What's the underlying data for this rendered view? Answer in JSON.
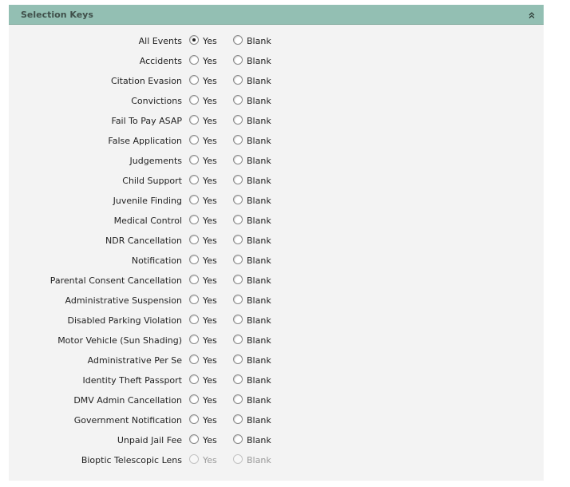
{
  "panel": {
    "title": "Selection Keys",
    "collapse_icon": "double-chevron-up-icon"
  },
  "options": {
    "yes": "Yes",
    "blank": "Blank"
  },
  "rows": [
    {
      "label": "All Events",
      "selected": "yes",
      "disabled": false
    },
    {
      "label": "Accidents",
      "selected": null,
      "disabled": false
    },
    {
      "label": "Citation Evasion",
      "selected": null,
      "disabled": false
    },
    {
      "label": "Convictions",
      "selected": null,
      "disabled": false
    },
    {
      "label": "Fail To Pay ASAP",
      "selected": null,
      "disabled": false
    },
    {
      "label": "False Application",
      "selected": null,
      "disabled": false
    },
    {
      "label": "Judgements",
      "selected": null,
      "disabled": false
    },
    {
      "label": "Child Support",
      "selected": null,
      "disabled": false
    },
    {
      "label": "Juvenile Finding",
      "selected": null,
      "disabled": false
    },
    {
      "label": "Medical Control",
      "selected": null,
      "disabled": false
    },
    {
      "label": "NDR Cancellation",
      "selected": null,
      "disabled": false
    },
    {
      "label": "Notification",
      "selected": null,
      "disabled": false
    },
    {
      "label": "Parental Consent Cancellation",
      "selected": null,
      "disabled": false
    },
    {
      "label": "Administrative Suspension",
      "selected": null,
      "disabled": false
    },
    {
      "label": "Disabled Parking Violation",
      "selected": null,
      "disabled": false
    },
    {
      "label": "Motor Vehicle (Sun Shading)",
      "selected": null,
      "disabled": false
    },
    {
      "label": "Administrative Per Se",
      "selected": null,
      "disabled": false
    },
    {
      "label": "Identity Theft Passport",
      "selected": null,
      "disabled": false
    },
    {
      "label": "DMV Admin Cancellation",
      "selected": null,
      "disabled": false
    },
    {
      "label": "Government Notification",
      "selected": null,
      "disabled": false
    },
    {
      "label": "Unpaid Jail Fee",
      "selected": null,
      "disabled": false
    },
    {
      "label": "Bioptic Telescopic Lens",
      "selected": null,
      "disabled": true
    }
  ]
}
